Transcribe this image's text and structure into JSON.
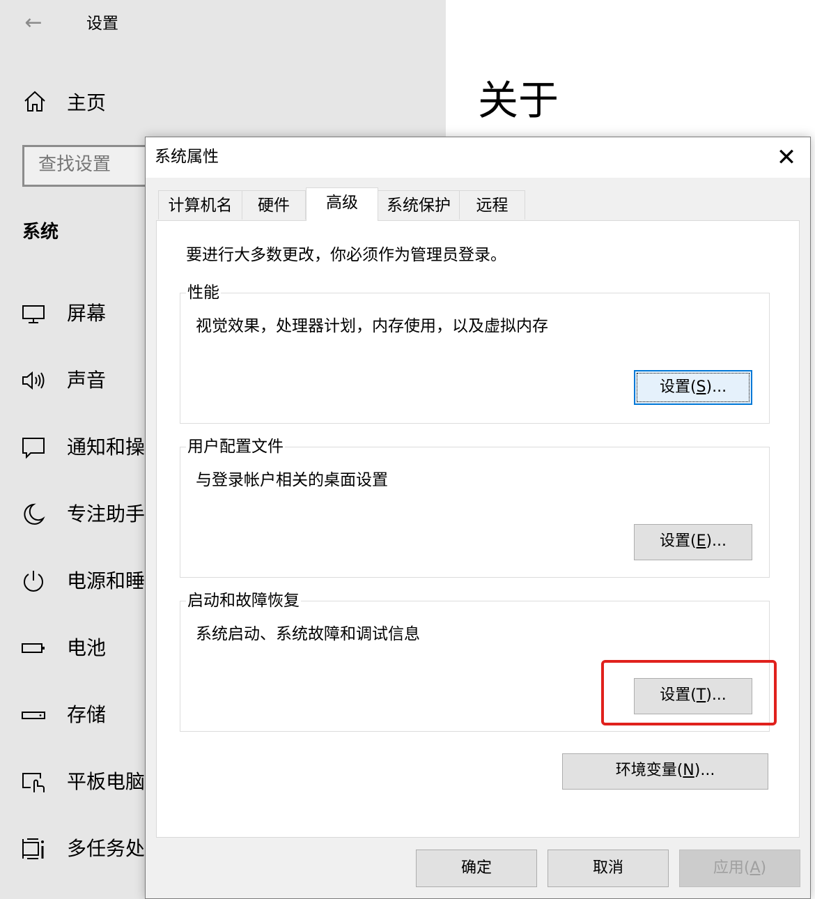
{
  "settings": {
    "back_glyph": "←",
    "title": "设置",
    "home_label": "主页",
    "search_placeholder": "查找设置",
    "section": "系统",
    "nav": [
      {
        "label": "屏幕",
        "icon": "monitor-icon"
      },
      {
        "label": "声音",
        "icon": "speaker-icon"
      },
      {
        "label": "通知和操",
        "icon": "notification-icon"
      },
      {
        "label": "专注助手",
        "icon": "moon-icon"
      },
      {
        "label": "电源和睡",
        "icon": "power-icon"
      },
      {
        "label": "电池",
        "icon": "battery-icon"
      },
      {
        "label": "存储",
        "icon": "storage-icon"
      },
      {
        "label": "平板电脑",
        "icon": "tablet-icon"
      },
      {
        "label": "多任务处",
        "icon": "multitask-icon"
      }
    ],
    "page_title": "关于"
  },
  "dialog": {
    "title": "系统属性",
    "close_glyph": "✕",
    "tabs": [
      "计算机名",
      "硬件",
      "高级",
      "系统保护",
      "远程"
    ],
    "active_tab": "高级",
    "notice": "要进行大多数更改，你必须作为管理员登录。",
    "groups": [
      {
        "legend": "性能",
        "desc": "视觉效果，处理器计划，内存使用，以及虚拟内存",
        "button_pre": "设置(",
        "button_key": "S",
        "button_post": ")..."
      },
      {
        "legend": "用户配置文件",
        "desc": "与登录帐户相关的桌面设置",
        "button_pre": "设置(",
        "button_key": "E",
        "button_post": ")..."
      },
      {
        "legend": "启动和故障恢复",
        "desc": "系统启动、系统故障和调试信息",
        "button_pre": "设置(",
        "button_key": "T",
        "button_post": ")..."
      }
    ],
    "env_button": {
      "pre": "环境变量(",
      "key": "N",
      "post": ")..."
    },
    "ok": "确定",
    "cancel": "取消",
    "apply": {
      "pre": "应用(",
      "key": "A",
      "post": ")"
    }
  },
  "colors": {
    "highlight": "#e0211d",
    "focus": "#0078d7"
  }
}
